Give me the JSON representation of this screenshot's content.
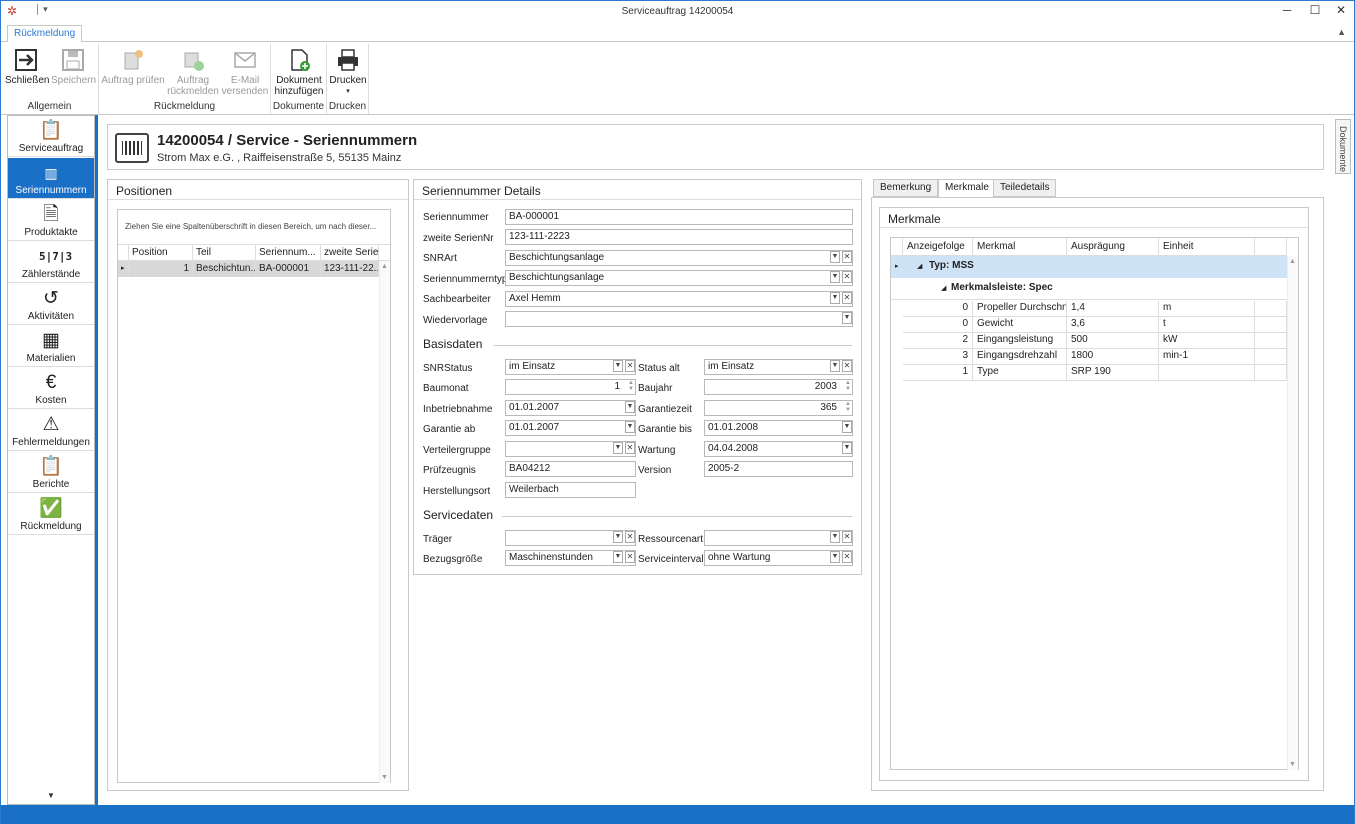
{
  "window": {
    "title": "Serviceauftrag 14200054"
  },
  "ribbon": {
    "tab": "Rückmeldung",
    "groups": [
      {
        "label": "Allgemein",
        "buttons": [
          "Schließen",
          "Speichern"
        ]
      },
      {
        "label": "Rückmeldung",
        "buttons": [
          "Auftrag prüfen",
          "Auftrag rückmelden",
          "E-Mail versenden"
        ]
      },
      {
        "label": "Dokumente",
        "buttons": [
          "Dokument hinzufügen"
        ]
      },
      {
        "label": "Drucken",
        "buttons": [
          "Drucken"
        ]
      }
    ]
  },
  "nav": {
    "items": [
      {
        "label": "Serviceauftrag",
        "icon": "service-order-icon"
      },
      {
        "label": "Seriennummern",
        "icon": "barcode-icon"
      },
      {
        "label": "Produktakte",
        "icon": "document-icon"
      },
      {
        "label": "Zählerstände",
        "icon": "counter-icon"
      },
      {
        "label": "Aktivitäten",
        "icon": "history-icon"
      },
      {
        "label": "Materialien",
        "icon": "boxes-icon"
      },
      {
        "label": "Kosten",
        "icon": "euro-icon"
      },
      {
        "label": "Fehlermeldungen",
        "icon": "warning-icon"
      },
      {
        "label": "Berichte",
        "icon": "clipboard-icon"
      },
      {
        "label": "Rückmeldung",
        "icon": "feedback-icon"
      }
    ]
  },
  "sidebar_right": {
    "label": "Dokumente"
  },
  "header": {
    "title": "14200054 / Service - Seriennummern",
    "subtitle": "Strom Max e.G. , Raiffeisenstraße 5, 55135 Mainz"
  },
  "positions": {
    "title": "Positionen",
    "group_hint": "Ziehen Sie eine Spaltenüberschrift in diesen Bereich, um nach dieser...",
    "columns": [
      "Position",
      "Teil",
      "Seriennum...",
      "zweite Serie..."
    ],
    "rows": [
      {
        "position": "1",
        "teil": "Beschichtun...",
        "seriennummer": "BA-000001",
        "zweite": "123-111-22..."
      }
    ]
  },
  "details": {
    "title": "Seriennummer Details",
    "seriennummer": {
      "label": "Seriennummer",
      "value": "BA-000001"
    },
    "zweite": {
      "label": "zweite SerienNr",
      "value": "123-111-2223"
    },
    "snrart": {
      "label": "SNRArt",
      "value": "Beschichtungsanlage"
    },
    "snrtyp": {
      "label": "Seriennummerntyp",
      "value": "Beschichtungsanlage"
    },
    "sachbearbeiter": {
      "label": "Sachbearbeiter",
      "value": "Axel Hemm"
    },
    "wiedervorlage": {
      "label": "Wiedervorlage",
      "value": ""
    },
    "basisdaten": {
      "title": "Basisdaten",
      "snrstatus": {
        "label": "SNRStatus",
        "value": "im Einsatz"
      },
      "status_alt": {
        "label": "Status alt",
        "value": "im Einsatz"
      },
      "baumonat": {
        "label": "Baumonat",
        "value": "1"
      },
      "baujahr": {
        "label": "Baujahr",
        "value": "2003"
      },
      "inbetriebnahme": {
        "label": "Inbetriebnahme",
        "value": "01.01.2007"
      },
      "garantiezeit": {
        "label": "Garantiezeit",
        "value": "365"
      },
      "garantie_ab": {
        "label": "Garantie ab",
        "value": "01.01.2007"
      },
      "garantie_bis": {
        "label": "Garantie bis",
        "value": "01.01.2008"
      },
      "verteilergruppe": {
        "label": "Verteilergruppe",
        "value": ""
      },
      "wartung": {
        "label": "Wartung",
        "value": "04.04.2008"
      },
      "pruefzeugnis": {
        "label": "Prüfzeugnis",
        "value": "BA04212"
      },
      "version": {
        "label": "Version",
        "value": "2005-2"
      },
      "herstellungsort": {
        "label": "Herstellungsort",
        "value": "Weilerbach"
      }
    },
    "servicedaten": {
      "title": "Servicedaten",
      "traeger": {
        "label": "Träger",
        "value": ""
      },
      "ressourcenart": {
        "label": "Ressourcenart",
        "value": ""
      },
      "bezugsgroesse": {
        "label": "Bezugsgröße",
        "value": "Maschinenstunden"
      },
      "serviceintervall": {
        "label": "Serviceintervall",
        "value": "ohne Wartung"
      }
    }
  },
  "merkmale": {
    "tabs": [
      "Bemerkung",
      "Merkmale",
      "Teiledetails"
    ],
    "title": "Merkmale",
    "columns": [
      "Anzeigefolge",
      "Merkmal",
      "Ausprägung",
      "Einheit"
    ],
    "group_type": "Typ: MSS",
    "group_leiste": "Merkmalsleiste: Spec",
    "rows": [
      {
        "folge": "0",
        "merkmal": "Propeller Durchschn.",
        "auspraegung": "1,4",
        "einheit": "m"
      },
      {
        "folge": "0",
        "merkmal": "Gewicht",
        "auspraegung": "3,6",
        "einheit": "t"
      },
      {
        "folge": "2",
        "merkmal": "Eingangsleistung",
        "auspraegung": "500",
        "einheit": "kW"
      },
      {
        "folge": "3",
        "merkmal": "Eingangsdrehzahl",
        "auspraegung": "1800",
        "einheit": "min-1"
      },
      {
        "folge": "1",
        "merkmal": "Type",
        "auspraegung": "SRP 190",
        "einheit": ""
      }
    ]
  },
  "colors": {
    "accent": "#1a6fc6",
    "selection": "#cfe3f7"
  }
}
